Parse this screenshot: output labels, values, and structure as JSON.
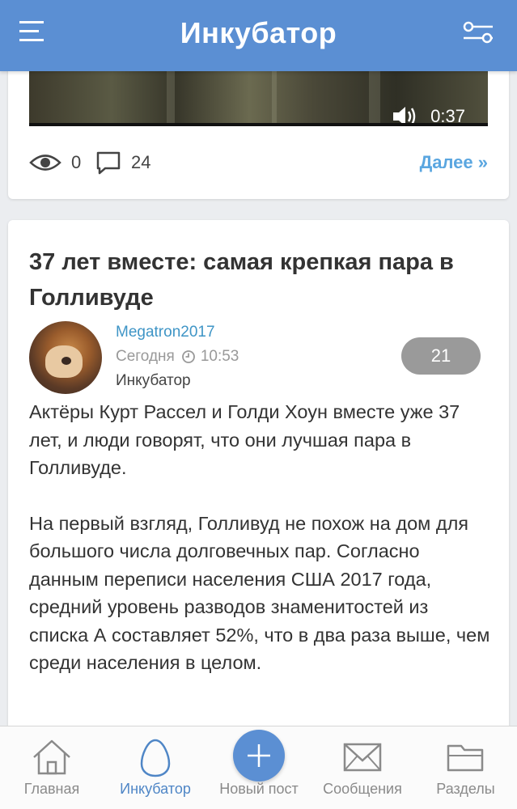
{
  "header": {
    "title": "Инкубатор",
    "menu_icon": "hamburger-icon",
    "filter_icon": "filter-sliders-icon"
  },
  "prev_post": {
    "video_duration": "0:37",
    "views": "0",
    "comments": "24",
    "more_label": "Далее »"
  },
  "post": {
    "title": "37 лет вместе: самая крепкая пара в Голливуде",
    "author": "Megatron2017",
    "date_label": "Сегодня",
    "time": "10:53",
    "section": "Инкубатор",
    "rating": "21",
    "paragraphs": [
      "Актёры Курт Рассел и Голди Хоун вместе уже 37 лет, и люди говорят, что они лучшая пара в Голливуде.",
      "На первый взгляд, Голливуд не похож на дом для большого числа долговечных пар. Согласно данным переписи населения США 2017 года, средний уровень разводов знаменитостей из списка А составляет 52%, что в два раза выше, чем среди населения в целом."
    ]
  },
  "nav": {
    "items": [
      {
        "label": "Главная",
        "icon": "home-icon"
      },
      {
        "label": "Инкубатор",
        "icon": "egg-icon"
      },
      {
        "label": "Новый пост",
        "icon": "plus-icon"
      },
      {
        "label": "Сообщения",
        "icon": "envelope-icon"
      },
      {
        "label": "Разделы",
        "icon": "folder-icon"
      }
    ]
  },
  "colors": {
    "header": "#5b8fd3",
    "link": "#3f95c6",
    "more": "#5aa6e0",
    "badge": "#9a9a9a",
    "nav_active": "#4f86c6"
  }
}
